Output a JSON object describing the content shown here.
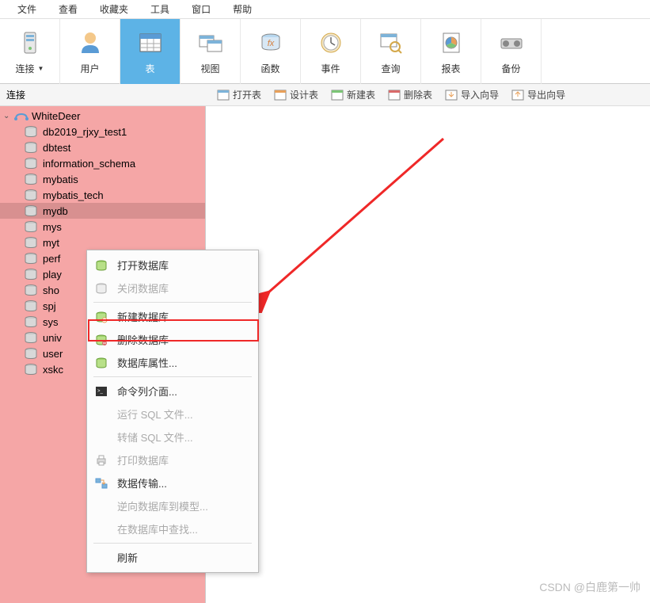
{
  "menubar": {
    "items": [
      "文件",
      "查看",
      "收藏夹",
      "工具",
      "窗口",
      "帮助"
    ]
  },
  "toolbar": {
    "buttons": [
      {
        "label": "连接",
        "icon": "server-icon",
        "dropdown": true
      },
      {
        "label": "用户",
        "icon": "user-icon"
      },
      {
        "label": "表",
        "icon": "table-icon",
        "active": true
      },
      {
        "label": "视图",
        "icon": "view-icon"
      },
      {
        "label": "函数",
        "icon": "function-icon"
      },
      {
        "label": "事件",
        "icon": "event-icon"
      },
      {
        "label": "查询",
        "icon": "query-icon"
      },
      {
        "label": "报表",
        "icon": "report-icon"
      },
      {
        "label": "备份",
        "icon": "backup-icon"
      }
    ]
  },
  "sub_toolbar": {
    "left_label": "连接",
    "buttons": [
      {
        "label": "打开表"
      },
      {
        "label": "设计表"
      },
      {
        "label": "新建表"
      },
      {
        "label": "删除表"
      },
      {
        "label": "导入向导"
      },
      {
        "label": "导出向导"
      }
    ]
  },
  "sidebar": {
    "connection": {
      "name": "WhiteDeer",
      "expanded": true
    },
    "databases": [
      {
        "name": "db2019_rjxy_test1"
      },
      {
        "name": "dbtest"
      },
      {
        "name": "information_schema"
      },
      {
        "name": "mybatis"
      },
      {
        "name": "mybatis_tech"
      },
      {
        "name": "mydb",
        "selected": true
      },
      {
        "name": "mys"
      },
      {
        "name": "myt"
      },
      {
        "name": "perf"
      },
      {
        "name": "play"
      },
      {
        "name": "sho"
      },
      {
        "name": "spj"
      },
      {
        "name": "sys"
      },
      {
        "name": "univ"
      },
      {
        "name": "user"
      },
      {
        "name": "xskc"
      }
    ]
  },
  "context_menu": {
    "items": [
      {
        "label": "打开数据库",
        "icon": "db-open",
        "enabled": true
      },
      {
        "label": "关闭数据库",
        "icon": "db-close",
        "enabled": false
      },
      {
        "sep": true
      },
      {
        "label": "新建数据库...",
        "icon": "db-new",
        "enabled": true
      },
      {
        "label": "删除数据库",
        "icon": "db-delete",
        "enabled": true,
        "highlighted": true
      },
      {
        "label": "数据库属性...",
        "icon": "db-props",
        "enabled": true
      },
      {
        "sep": true
      },
      {
        "label": "命令列介面...",
        "icon": "console",
        "enabled": true
      },
      {
        "label": "运行 SQL 文件...",
        "icon": "",
        "enabled": false
      },
      {
        "label": "转储 SQL 文件...",
        "icon": "",
        "enabled": false
      },
      {
        "label": "打印数据库",
        "icon": "print",
        "enabled": false
      },
      {
        "label": "数据传输...",
        "icon": "transfer",
        "enabled": true
      },
      {
        "label": "逆向数据库到模型...",
        "icon": "",
        "enabled": false
      },
      {
        "label": "在数据库中查找...",
        "icon": "",
        "enabled": false
      },
      {
        "sep": true
      },
      {
        "label": "刷新",
        "icon": "",
        "enabled": true
      }
    ]
  },
  "watermark": "CSDN @白鹿第一帅",
  "colors": {
    "active_blue": "#5db3e6",
    "sidebar_pink": "#f5a6a6",
    "highlight_red": "#ef2828"
  }
}
